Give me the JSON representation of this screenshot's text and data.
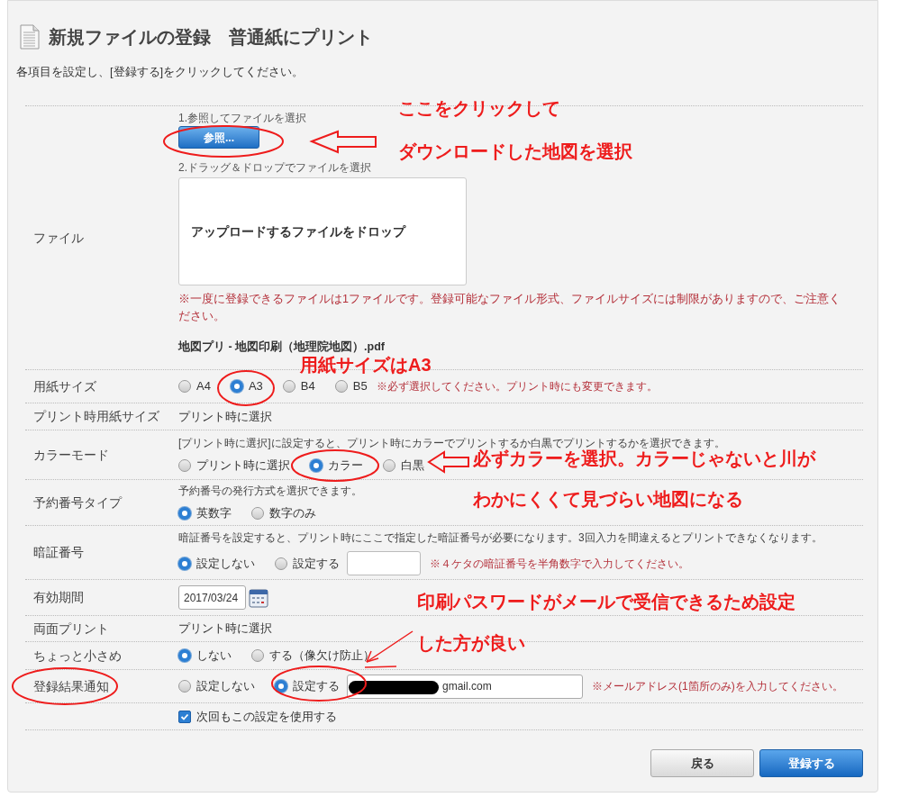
{
  "header": {
    "title": "新規ファイルの登録　普通紙にプリント",
    "instruction": "各項目を設定し、[登録する]をクリックしてください。"
  },
  "rows": [
    {
      "kind": "file",
      "label": "ファイル",
      "step1": "1.参照してファイルを選択",
      "browse_button": "参照...",
      "step2": "2.ドラッグ＆ドロップでファイルを選択",
      "dropzone": "アップロードするファイルをドロップ",
      "note": "※一度に登録できるファイルは1ファイルです。登録可能なファイル形式、ファイルサイズには制限がありますので、ご注意ください。",
      "filename": "地図プリ - 地図印刷（地理院地図）.pdf"
    },
    {
      "kind": "choice",
      "label": "用紙サイズ",
      "options": [
        {
          "label": "A4",
          "selected": false
        },
        {
          "label": "A3",
          "selected": true
        },
        {
          "label": "B4",
          "selected": false
        },
        {
          "label": "B5",
          "selected": false
        }
      ],
      "note": "※必ず選択してください。プリント時にも変更できます。"
    },
    {
      "kind": "text",
      "label": "プリント時用紙サイズ",
      "value": "プリント時に選択"
    },
    {
      "kind": "choice",
      "label": "カラーモード",
      "description": "[プリント時に選択]に設定すると、プリント時にカラーでプリントするか白黒でプリントするかを選択できます。",
      "options": [
        {
          "label": "プリント時に選択",
          "selected": false
        },
        {
          "label": "カラー",
          "selected": true
        },
        {
          "label": "白黒",
          "selected": false
        }
      ]
    },
    {
      "kind": "choice",
      "label": "予約番号タイプ",
      "description": "予約番号の発行方式を選択できます。",
      "options": [
        {
          "label": "英数字",
          "selected": true
        },
        {
          "label": "数字のみ",
          "selected": false
        }
      ]
    },
    {
      "kind": "choice",
      "label": "暗証番号",
      "description": "暗証番号を設定すると、プリント時にここで指定した暗証番号が必要になります。3回入力を間違えるとプリントできなくなります。",
      "options": [
        {
          "label": "設定しない",
          "selected": true
        },
        {
          "label": "設定する",
          "selected": false
        }
      ],
      "field": {
        "kind": "pin"
      },
      "note": "※４ケタの暗証番号を半角数字で入力してください。"
    },
    {
      "kind": "date",
      "label": "有効期間",
      "value": "2017/03/24"
    },
    {
      "kind": "text",
      "label": "両面プリント",
      "value": "プリント時に選択"
    },
    {
      "kind": "choice",
      "label": "ちょっと小さめ",
      "options": [
        {
          "label": "しない",
          "selected": true
        },
        {
          "label": "する（像欠け防止）",
          "selected": false
        }
      ]
    },
    {
      "kind": "choice",
      "label": "登録結果通知",
      "options": [
        {
          "label": "設定しない",
          "selected": false
        },
        {
          "label": "設定する",
          "selected": true
        }
      ],
      "field": {
        "kind": "email",
        "value": "gmail.com",
        "redacted": true
      },
      "note": "※メールアドレス(1箇所のみ)を入力してください。"
    },
    {
      "kind": "checkbox",
      "checkbox": {
        "label": "次回もこの設定を使用する",
        "checked": true
      }
    }
  ],
  "buttons": [
    {
      "label": "戻る",
      "kind": "secondary"
    },
    {
      "label": "登録する",
      "kind": "primary"
    }
  ],
  "annotations": [
    {
      "text": "ここをクリックして"
    },
    {
      "text": "ダウンロードした地図を選択"
    },
    {
      "text": "用紙サイズはA3"
    },
    {
      "text": "必ずカラーを選択。カラーじゃないと川が"
    },
    {
      "text": "わかにくくて見づらい地図になる"
    },
    {
      "text": "印刷パスワードがメールで受信できるため設定"
    },
    {
      "text": "した方が良い"
    }
  ]
}
